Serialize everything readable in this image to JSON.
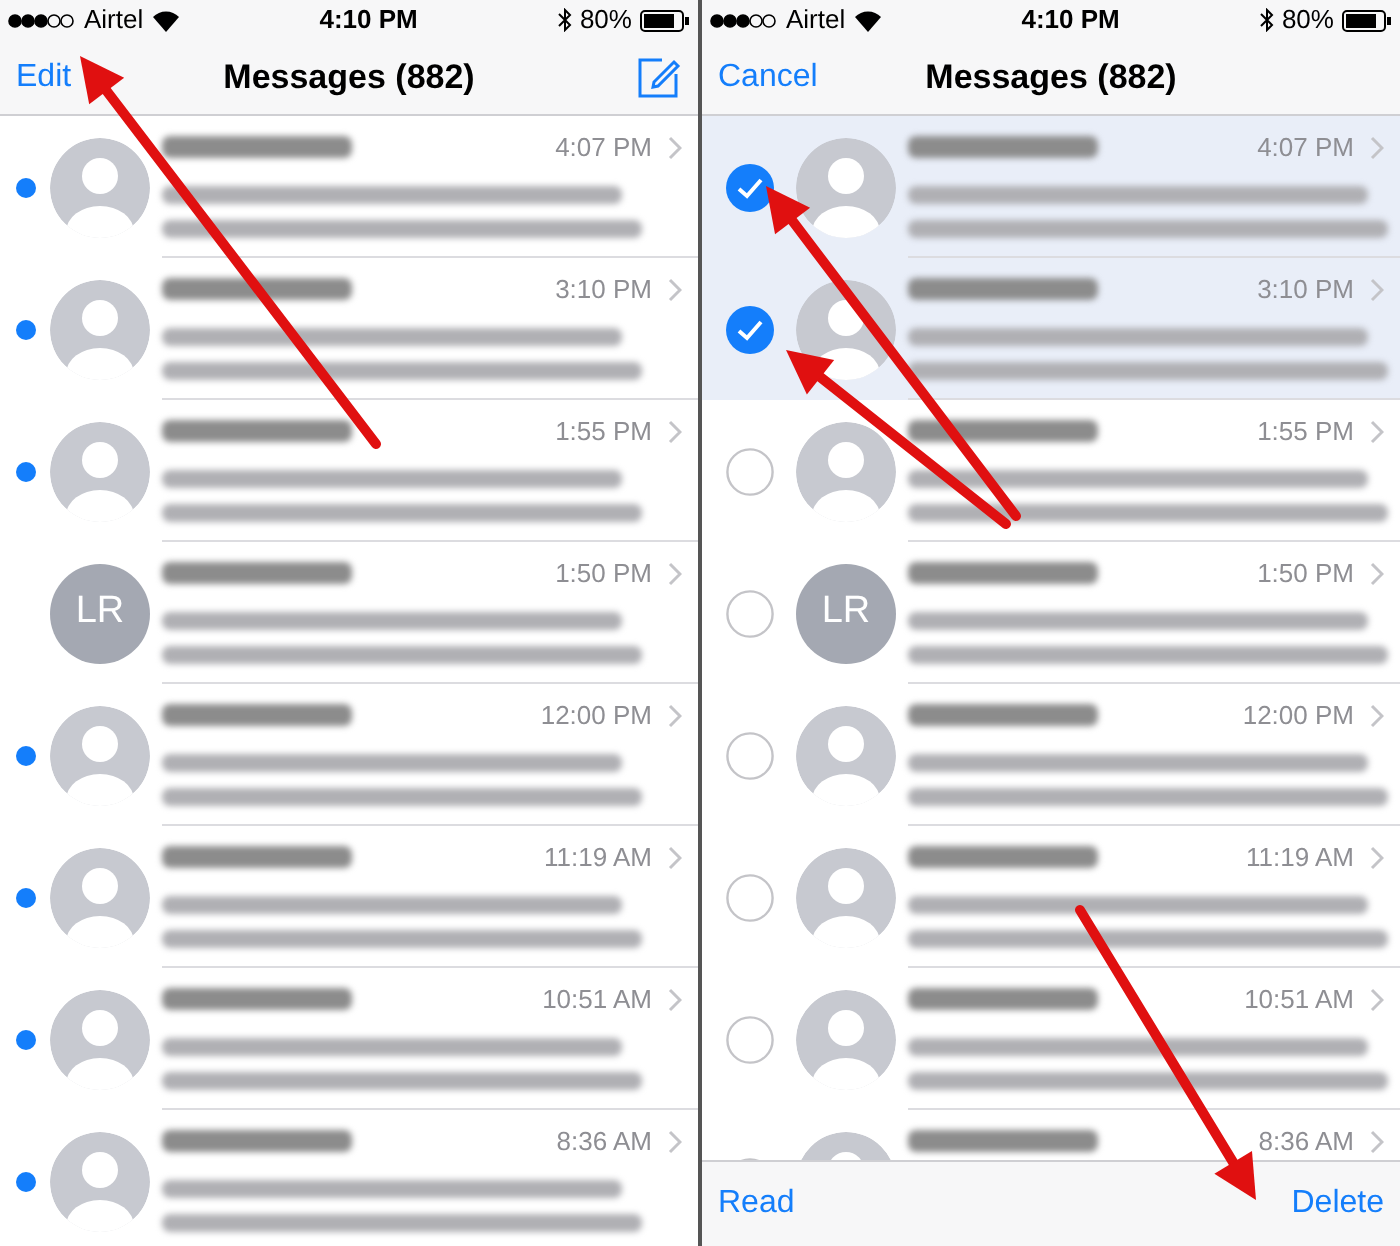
{
  "panels": [
    {
      "status": {
        "carrier": "Airtel",
        "time": "4:10 PM",
        "battery": "80%"
      },
      "nav": {
        "left": "Edit",
        "title": "Messages (882)",
        "compose": true
      },
      "editing": false,
      "rows": [
        {
          "time": "4:07 PM",
          "unread": true
        },
        {
          "time": "3:10 PM",
          "unread": true
        },
        {
          "time": "1:55 PM",
          "unread": true
        },
        {
          "time": "1:50 PM",
          "unread": false,
          "initials": "LR"
        },
        {
          "time": "12:00 PM",
          "unread": true
        },
        {
          "time": "11:19 AM",
          "unread": true
        },
        {
          "time": "10:51 AM",
          "unread": true
        },
        {
          "time": "8:36 AM",
          "unread": true
        }
      ]
    },
    {
      "status": {
        "carrier": "Airtel",
        "time": "4:10 PM",
        "battery": "80%"
      },
      "nav": {
        "left": "Cancel",
        "title": "Messages (882)",
        "compose": false
      },
      "editing": true,
      "rows": [
        {
          "time": "4:07 PM",
          "selected": true
        },
        {
          "time": "3:10 PM",
          "selected": true
        },
        {
          "time": "1:55 PM",
          "selected": false
        },
        {
          "time": "1:50 PM",
          "selected": false,
          "initials": "LR"
        },
        {
          "time": "12:00 PM",
          "selected": false
        },
        {
          "time": "11:19 AM",
          "selected": false
        },
        {
          "time": "10:51 AM",
          "selected": false
        },
        {
          "time": "8:36 AM",
          "selected": false
        }
      ],
      "toolbar": {
        "left": "Read",
        "right": "Delete"
      }
    }
  ]
}
